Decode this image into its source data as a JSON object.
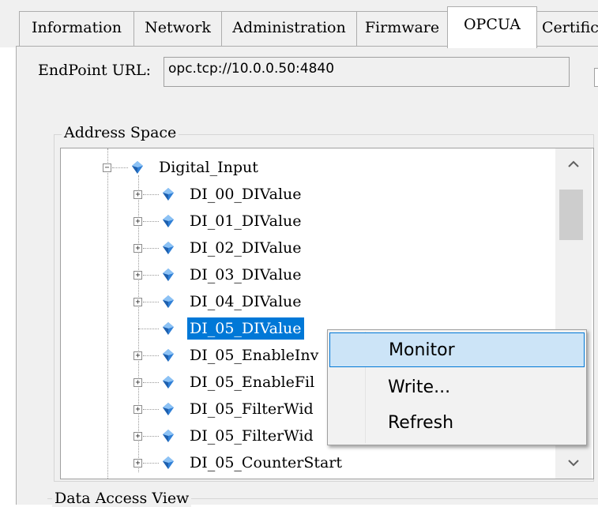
{
  "tabs": [
    {
      "label": "Information"
    },
    {
      "label": "Network"
    },
    {
      "label": "Administration"
    },
    {
      "label": "Firmware"
    },
    {
      "label": "OPCUA",
      "active": true
    },
    {
      "label": "Certific"
    }
  ],
  "endpoint": {
    "label": "EndPoint URL:",
    "value": "opc.tcp://10.0.0.50:4840"
  },
  "address_space": {
    "title": "Address Space",
    "parent": {
      "label": "Digital_Input",
      "expanded": true
    },
    "items": [
      {
        "label": "DI_00_DIValue",
        "expander": "+"
      },
      {
        "label": "DI_01_DIValue",
        "expander": "+"
      },
      {
        "label": "DI_02_DIValue",
        "expander": "+"
      },
      {
        "label": "DI_03_DIValue",
        "expander": "+"
      },
      {
        "label": "DI_04_DIValue",
        "expander": "+"
      },
      {
        "label": "DI_05_DIValue",
        "expander": "",
        "selected": true
      },
      {
        "label": "DI_05_EnableInv",
        "expander": "+"
      },
      {
        "label": "DI_05_EnableFil",
        "expander": "+"
      },
      {
        "label": "DI_05_FilterWid",
        "expander": "+"
      },
      {
        "label": "DI_05_FilterWid",
        "expander": "+"
      },
      {
        "label": "DI_05_CounterStart",
        "expander": "+"
      }
    ]
  },
  "data_access_view": {
    "title": "Data Access View"
  },
  "context_menu": {
    "items": [
      {
        "label": "Monitor",
        "highlighted": true
      },
      {
        "label": "Write..."
      },
      {
        "label": "Refresh"
      }
    ]
  },
  "icons": {
    "node": "diamond-node-icon",
    "expand": "plus-box-icon",
    "collapse": "minus-box-icon",
    "scroll_up": "chevron-up-icon",
    "scroll_down": "chevron-down-icon"
  },
  "colors": {
    "selection": "#0078d7",
    "menu_highlight": "#cce4f7",
    "node_icon": "#2f7fd6"
  }
}
